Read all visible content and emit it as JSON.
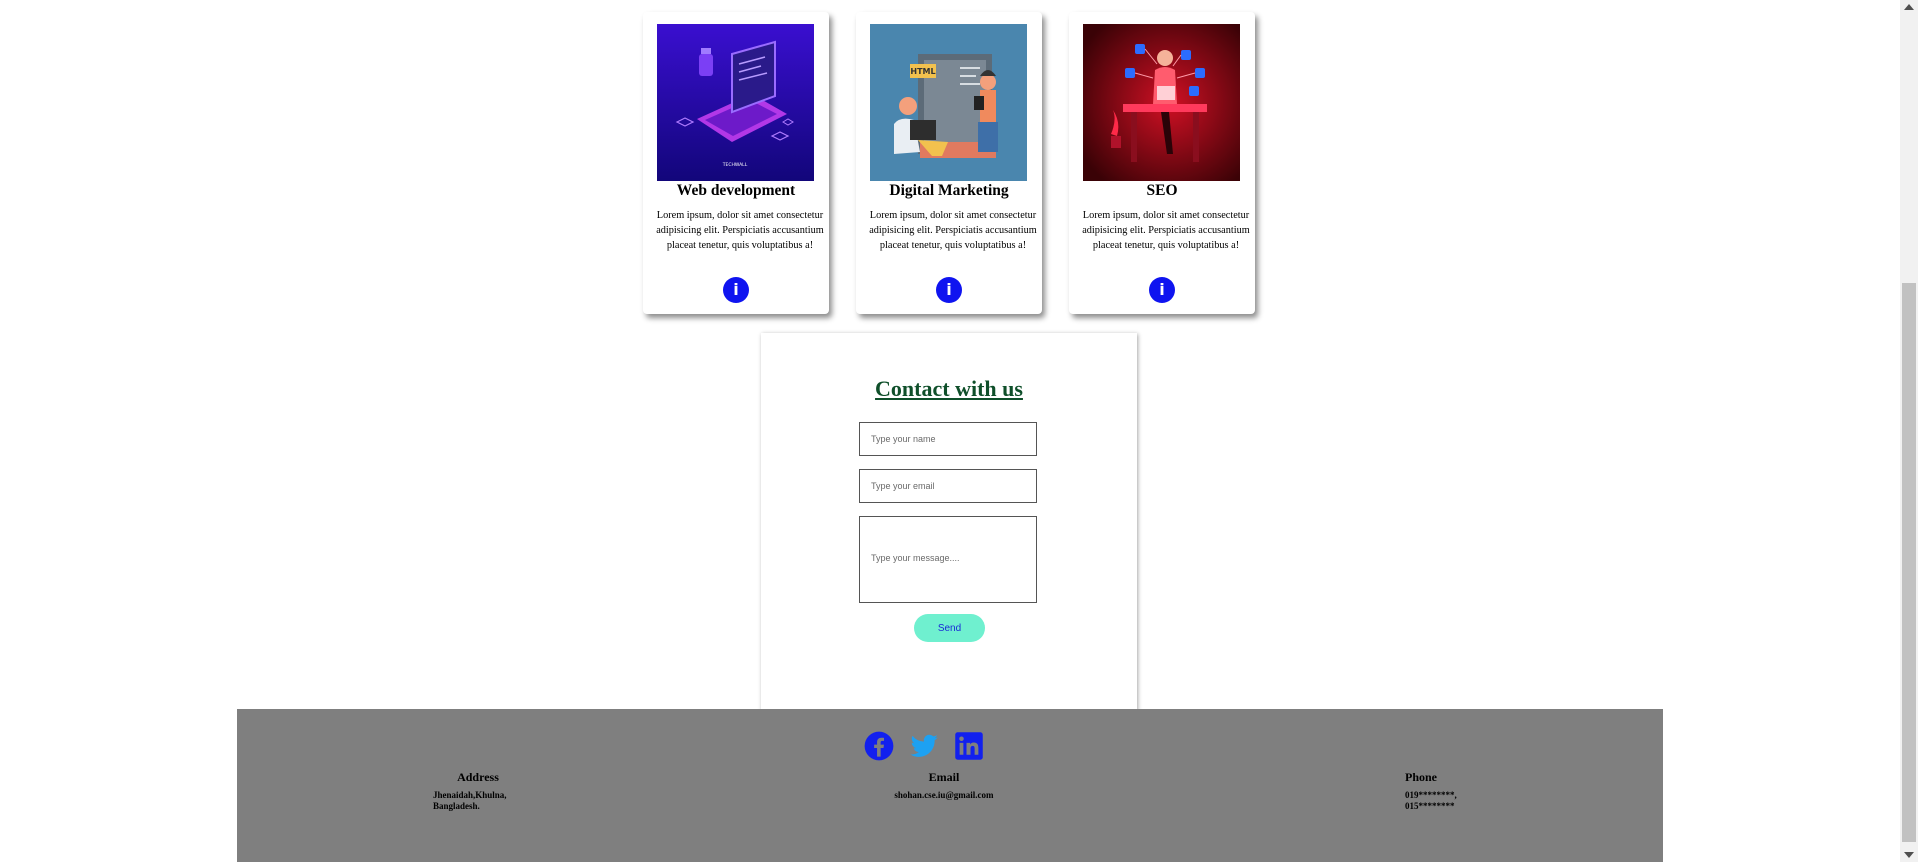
{
  "services": [
    {
      "title": "Web development",
      "description": "Lorem ipsum, dolor sit amet consectetur adipisicing elit. Perspiciatis accusantium placeat tenetur, quis voluptatibus a!",
      "image_caption": "TECHWALL",
      "info_icon": "i"
    },
    {
      "title": "Digital Marketing",
      "description": "Lorem ipsum, dolor sit amet consectetur adipisicing elit. Perspiciatis accusantium placeat tenetur, quis voluptatibus a!",
      "image_badge": "HTML",
      "info_icon": "i"
    },
    {
      "title": "SEO",
      "description": "Lorem ipsum, dolor sit amet consectetur adipisicing elit. Perspiciatis accusantium placeat tenetur, quis voluptatibus a!",
      "info_icon": "i"
    }
  ],
  "contact": {
    "title": "Contact with us",
    "name_placeholder": "Type your name",
    "email_placeholder": "Type your email",
    "message_placeholder": "Type your message....",
    "send_label": "Send"
  },
  "footer": {
    "social": [
      "facebook-icon",
      "twitter-icon",
      "linkedin-icon"
    ],
    "address": {
      "heading": "Address",
      "line1": "Jhenaidah,Khulna,",
      "line2": "Bangladesh."
    },
    "email": {
      "heading": "Email",
      "value": "shohan.cse.iu@gmail.com"
    },
    "phone": {
      "heading": "Phone",
      "line1": "019********,",
      "line2": "015********"
    }
  },
  "colors": {
    "accent": "#0f14f0",
    "contact_title": "#0f4f2a",
    "send_button": "#6ff0cf",
    "footer_bg": "#7f7f7f"
  }
}
